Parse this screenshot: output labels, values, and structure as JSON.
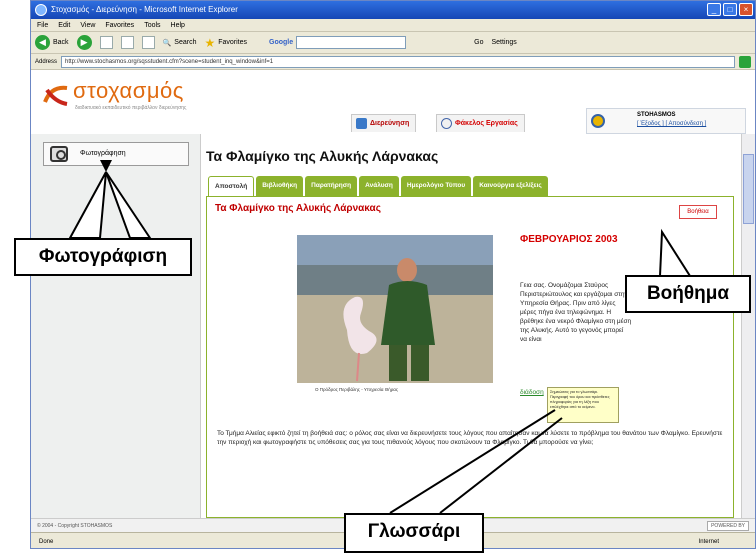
{
  "browser": {
    "title": "Στοχασμός - Διερεύνηση - Microsoft Internet Explorer",
    "menu": [
      "File",
      "Edit",
      "View",
      "Favorites",
      "Tools",
      "Help"
    ],
    "toolbar": {
      "back": "Back",
      "search": "Search",
      "favorites": "Favorites",
      "google": "Google",
      "go": "Go",
      "settings": "Settings"
    },
    "address_label": "Address",
    "address": "http://www.stochasmos.org/sqsstudent.cfm?scene=student_inq_window&inf=1"
  },
  "site": {
    "logo": "στοχασμός",
    "tagline": "διαδικτυακό εκπαιδευτικό περιβάλλον διερεύνησης",
    "tabs": [
      "Διερεύνηση",
      "Φάκελος Εργασίας"
    ],
    "user": {
      "name": "STOHASMOS",
      "links": "[ Έξοδος ] [ Αποσύνδεση ]"
    }
  },
  "sidebar": {
    "items": [
      {
        "label": "Φωτογράφηση"
      }
    ]
  },
  "main": {
    "page_title": "Τα Φλαμίγκο της Αλυκής Λάρνακας",
    "tabs": [
      "Αποστολή",
      "Βιβλιοθήκη",
      "Παρατήρηση",
      "Ανάλυση",
      "Ημερολόγιο Τύπου",
      "Καινούργια εξελίξεις"
    ],
    "section_title": "Τα Φλαμίγκο της Αλυκής Λάρνακας",
    "help_label": "Βοήθεια",
    "photo_caption": "Ο Πρόδρος Περιβάλης - Υπηρεσία Θήρας",
    "month": "ΦΕΒΡΟΥΑΡΙΟΣ 2003",
    "side_text": "Γεια σας. Ονομάζομαι Σταύρος Περιστεριώτουλος και εργάζομαι στην Υπηρεσία Θήρας. Πριν από λίγες μέρες πήγα ένα τηλεφώνημα. Η βρέθηκε ένα νεκρό Φλαμίγκο στη μέση της Αλυκής. Αυτό το γεγονός μπορεί να είναι",
    "gloss_link": "διάδοση",
    "tooltip": "Σημειώσεις για το γλωσσάρι. Περιγραφή του όρου και πρόσθετες πληροφορίες για τη λέξη που επιλέχθηκε από το κείμενο.",
    "bottom_text": "Το Τμήμα Αλιείας εφικτό ζητεί τη βοήθειά σας: ο ρόλος σας είναι να διερευνήσετε τους λόγους που απαίτησαν και να λύσετε το πρόβλημα του θανάτου των Φλαμίγκο. Ερευνήστε την περιοχή και φωτογραφήστε τις υπόθεσεις σας για τους πιθανούς λόγους που σκοτώνουν τα Φλαμίγκο. Τι θα μπορούσε να γίνει;"
  },
  "footer": {
    "copyright": "© 2004 - Copyright STOHASMOS",
    "powered": "POWERED BY"
  },
  "status": {
    "left": "Done",
    "zone": "Internet"
  },
  "callouts": {
    "photo": "Φωτογράφιση",
    "help": "Βοήθημα",
    "glossary": "Γλωσσάρι"
  },
  "colors": {
    "accent_green": "#8cb22c",
    "title_red": "#c00000",
    "logo_orange": "#e06a10"
  }
}
